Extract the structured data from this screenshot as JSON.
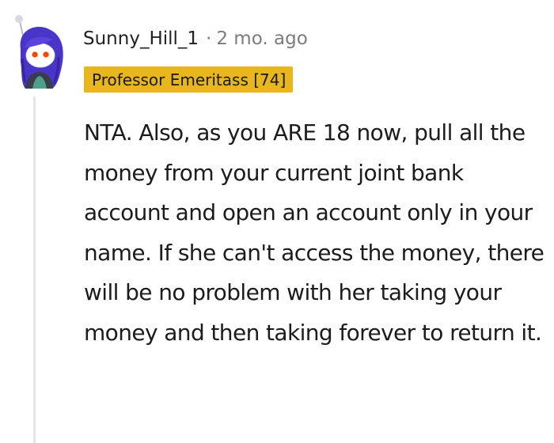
{
  "comment": {
    "author": "Sunny_Hill_1",
    "separator": "·",
    "timestamp": "2 mo. ago",
    "flair": "Professor Emeritass [74]",
    "body": "NTA. Also, as you ARE 18 now, pull all the money from your current joint bank account and open an account only in your name. If she can't access the money, there will be no problem with her taking your money and then taking forever to return it."
  },
  "colors": {
    "flair_background": "#e8b71d",
    "thread_line": "#e5e6e8",
    "avatar_hair": "#4a35c9",
    "avatar_eyes": "#ff4500",
    "timestamp_text": "#7c7c7c"
  },
  "icons": {
    "avatar": "reddit-snoo-avatar-icon"
  }
}
